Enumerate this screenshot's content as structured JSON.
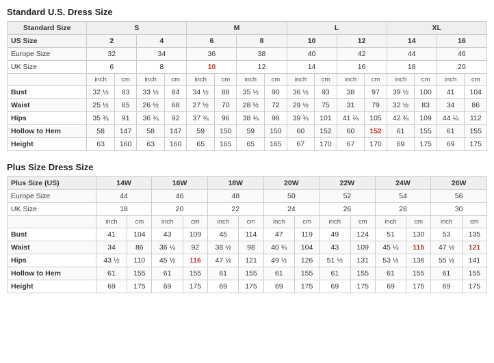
{
  "standard": {
    "title": "Standard U.S. Dress Size",
    "sizeGroups": [
      {
        "label": "Standard Size",
        "colspan": 1
      },
      {
        "label": "S",
        "colspan": 4
      },
      {
        "label": "M",
        "colspan": 4
      },
      {
        "label": "L",
        "colspan": 4
      },
      {
        "label": "XL",
        "colspan": 4
      }
    ],
    "usSizes": [
      "",
      "2",
      "4",
      "6",
      "8",
      "10",
      "12",
      "14",
      "16"
    ],
    "europeSizes": [
      "Europe Size",
      "32",
      "34",
      "36",
      "38",
      "40",
      "42",
      "44",
      "46"
    ],
    "ukSizes": [
      "UK Size",
      "6",
      "8",
      "10",
      "12",
      "14",
      "16",
      "18",
      "20"
    ],
    "ukHighlight": [
      2
    ],
    "unitRow": [
      "",
      "inch",
      "cm",
      "inch",
      "cm",
      "inch",
      "cm",
      "inch",
      "cm",
      "inch",
      "cm",
      "inch",
      "cm",
      "inch",
      "cm",
      "inch",
      "cm"
    ],
    "measurements": [
      {
        "label": "Bust",
        "values": [
          "32 ½",
          "83",
          "33 ½",
          "84",
          "34 ½",
          "88",
          "35 ½",
          "90",
          "36 ½",
          "93",
          "38",
          "97",
          "39 ½",
          "100",
          "41",
          "104"
        ]
      },
      {
        "label": "Waist",
        "values": [
          "25 ½",
          "65",
          "26 ½",
          "68",
          "27 ½",
          "70",
          "28 ½",
          "72",
          "29 ½",
          "75",
          "31",
          "79",
          "32 ½",
          "83",
          "34",
          "86"
        ]
      },
      {
        "label": "Hips",
        "values": [
          "35 ¾",
          "91",
          "36 ¾",
          "92",
          "37 ¾",
          "96",
          "38 ¾",
          "98",
          "39 ¾",
          "101",
          "41 ¼",
          "105",
          "42 ¾",
          "109",
          "44 ¼",
          "112"
        ]
      },
      {
        "label": "Hollow to Hem",
        "values": [
          "58",
          "147",
          "58",
          "147",
          "59",
          "150",
          "59",
          "150",
          "60",
          "152",
          "60",
          "152",
          "61",
          "155",
          "61",
          "155"
        ],
        "highlight": [
          11
        ]
      },
      {
        "label": "Height",
        "values": [
          "63",
          "160",
          "63",
          "160",
          "65",
          "165",
          "65",
          "165",
          "67",
          "170",
          "67",
          "170",
          "69",
          "175",
          "69",
          "175"
        ]
      }
    ]
  },
  "plus": {
    "title": "Plus Size Dress Size",
    "sizeGroups": [
      {
        "label": "Plus Size (US)",
        "colspan": 1
      },
      {
        "label": "14W",
        "colspan": 2
      },
      {
        "label": "16W",
        "colspan": 2
      },
      {
        "label": "18W",
        "colspan": 2
      },
      {
        "label": "20W",
        "colspan": 2
      },
      {
        "label": "22W",
        "colspan": 2
      },
      {
        "label": "24W",
        "colspan": 2
      },
      {
        "label": "26W",
        "colspan": 2
      }
    ],
    "europeSizes": [
      "Europe Size",
      "44",
      "46",
      "48",
      "50",
      "52",
      "54",
      "56"
    ],
    "ukSizes": [
      "UK Size",
      "18",
      "20",
      "22",
      "24",
      "26",
      "28",
      "30"
    ],
    "unitRow": [
      "",
      "inch",
      "cm",
      "inch",
      "cm",
      "inch",
      "cm",
      "inch",
      "cm",
      "inch",
      "cm",
      "inch",
      "cm",
      "inch",
      "cm"
    ],
    "measurements": [
      {
        "label": "Bust",
        "values": [
          "41",
          "104",
          "43",
          "109",
          "45",
          "114",
          "47",
          "119",
          "49",
          "124",
          "51",
          "130",
          "53",
          "135"
        ]
      },
      {
        "label": "Waist",
        "values": [
          "34",
          "86",
          "36 ¼",
          "92",
          "38 ½",
          "98",
          "40 ¾",
          "104",
          "43",
          "109",
          "45 ¼",
          "115",
          "47 ½",
          "121"
        ],
        "highlight": [
          11,
          13
        ]
      },
      {
        "label": "Hips",
        "values": [
          "43 ½",
          "110",
          "45 ½",
          "116",
          "47 ½",
          "121",
          "49 ½",
          "126",
          "51 ½",
          "131",
          "53 ½",
          "136",
          "55 ½",
          "141"
        ],
        "highlight": [
          3,
          11
        ]
      },
      {
        "label": "Hollow to Hem",
        "values": [
          "61",
          "155",
          "61",
          "155",
          "61",
          "155",
          "61",
          "155",
          "61",
          "155",
          "61",
          "155",
          "61",
          "155"
        ]
      },
      {
        "label": "Height",
        "values": [
          "69",
          "175",
          "69",
          "175",
          "69",
          "175",
          "69",
          "175",
          "69",
          "175",
          "69",
          "175",
          "69",
          "175"
        ]
      }
    ]
  }
}
